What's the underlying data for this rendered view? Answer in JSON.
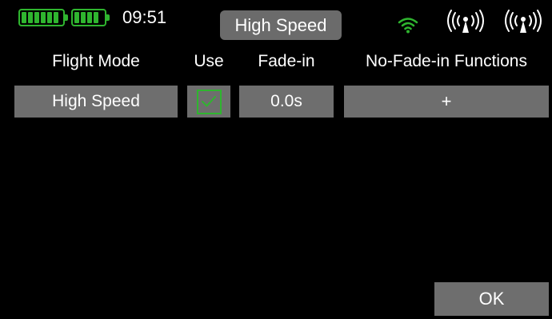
{
  "status": {
    "time": "09:51",
    "battery1": "battery-icon",
    "battery2": "battery-icon",
    "wifi": "wifi-icon",
    "antenna": "antenna-icon",
    "accent_color": "#2fb52f"
  },
  "title": "High Speed",
  "table": {
    "headers": [
      "Flight Mode",
      "Use",
      "Fade-in",
      "No-Fade-in Functions"
    ],
    "rows": [
      {
        "flight_mode": "High Speed",
        "use": true,
        "fade_in": "0.0s",
        "no_fade_in": "+"
      }
    ]
  },
  "ok_label": "OK"
}
